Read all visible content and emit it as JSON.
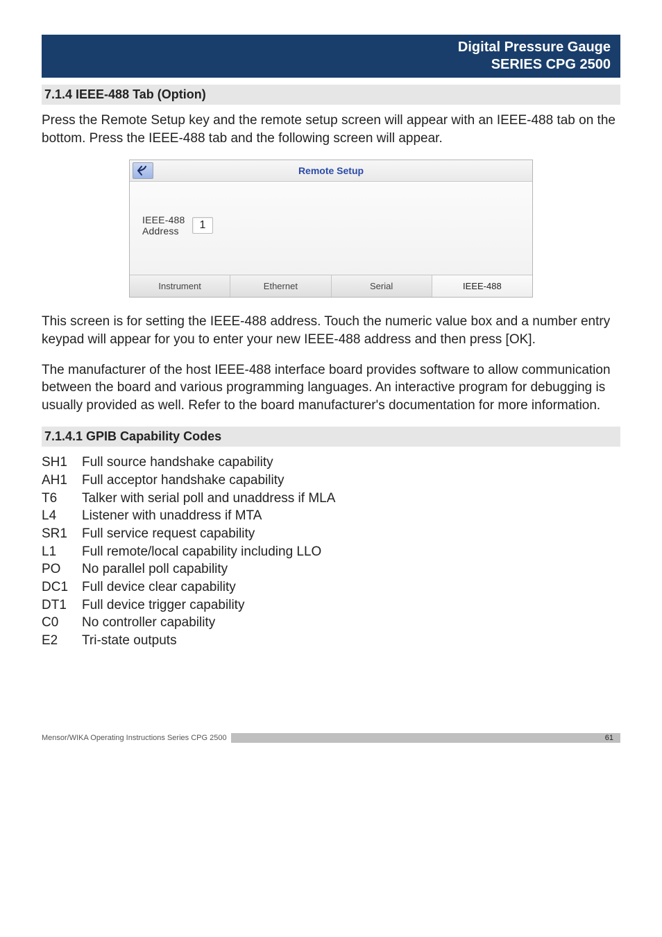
{
  "header": {
    "line1": "Digital Pressure Gauge",
    "line2": "SERIES CPG 2500"
  },
  "section_714": {
    "title": "7.1.4 IEEE-488 Tab (Option)",
    "para1": "Press the Remote Setup key and the remote setup screen will appear with an IEEE-488 tab on the bottom. Press the IEEE-488 tab and the following screen will appear."
  },
  "screenshot": {
    "title": "Remote Setup",
    "field_label_l1": "IEEE-488",
    "field_label_l2": "Address",
    "field_value": "1",
    "tabs": [
      "Instrument",
      "Ethernet",
      "Serial",
      "IEEE-488"
    ],
    "active_tab_index": 3
  },
  "after_screenshot": {
    "para1": "This screen is for setting the IEEE-488 address. Touch the numeric value box and a number entry keypad will appear for you to enter your new IEEE-488 address and then press [OK].",
    "para2": "The manufacturer of the host IEEE-488 interface board provides software to allow communication between the board and various programming languages. An interactive program for debugging is usually provided as well. Refer to the board manufacturer's documentation for more information."
  },
  "section_71411": {
    "title": "7.1.4.1 GPIB Capability Codes",
    "codes": [
      {
        "k": "SH1",
        "v": "Full source handshake capability"
      },
      {
        "k": "AH1",
        "v": "Full acceptor handshake capability"
      },
      {
        "k": "T6",
        "v": "Talker with serial poll and unaddress if MLA"
      },
      {
        "k": "L4",
        "v": "Listener with unaddress if MTA"
      },
      {
        "k": "SR1",
        "v": "Full service request capability"
      },
      {
        "k": "L1",
        "v": "Full remote/local capability including LLO"
      },
      {
        "k": "PO",
        "v": "No parallel poll capability"
      },
      {
        "k": "DC1",
        "v": "Full device clear capability"
      },
      {
        "k": "DT1",
        "v": "Full device trigger capability"
      },
      {
        "k": "C0",
        "v": "No controller capability"
      },
      {
        "k": "E2",
        "v": "Tri-state outputs"
      }
    ]
  },
  "footer": {
    "text": "Mensor/WIKA Operating Instructions Series CPG 2500",
    "page": "61"
  }
}
